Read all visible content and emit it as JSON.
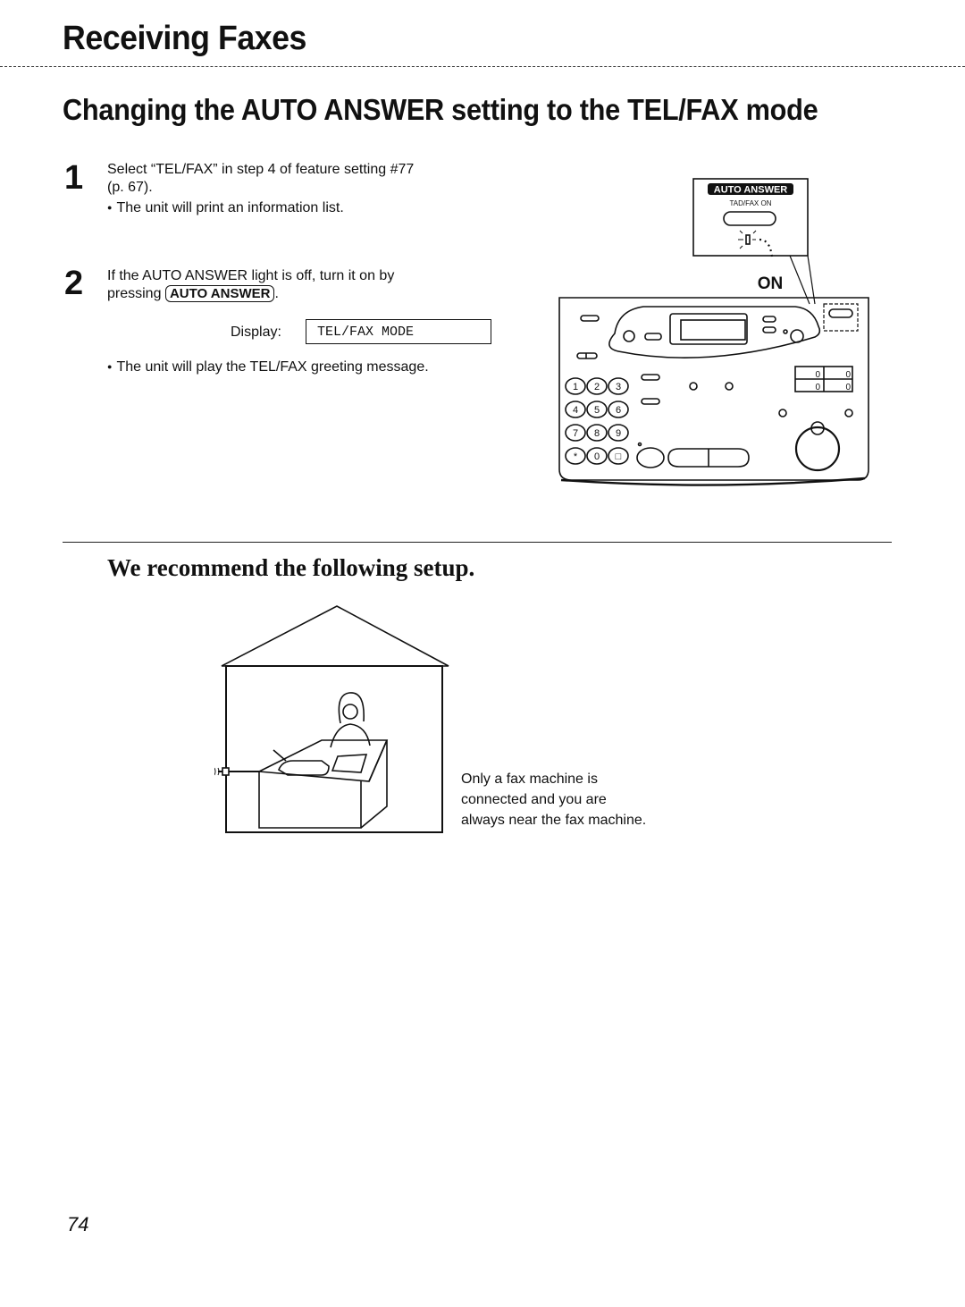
{
  "header": {
    "section_title": "Receiving Faxes",
    "subtitle": "Changing the AUTO ANSWER setting to the TEL/FAX mode"
  },
  "steps": [
    {
      "number": "1",
      "text_line1": "Select “TEL/FAX” in step 4 of feature setting #77",
      "text_line2": "(p. 67).",
      "bullet": "The unit will print an information list."
    },
    {
      "number": "2",
      "text_line1": "If the AUTO ANSWER light is off, turn it on by",
      "text_prefix": "pressing",
      "key_label": "AUTO ANSWER",
      "text_suffix": ".",
      "display_label": "Display:",
      "display_value": "TEL/FAX MODE",
      "bullet": "The unit will play the TEL/FAX greeting message."
    }
  ],
  "illustration_fax": {
    "callout_button_label": "AUTO ANSWER",
    "callout_sub_label": "TAD/FAX ON",
    "on_label": "ON",
    "keypad": [
      "1",
      "2",
      "3",
      "4",
      "5",
      "6",
      "7",
      "8",
      "9",
      "*",
      "0",
      "□"
    ],
    "counter_digits": [
      "0",
      "0",
      "0",
      "0"
    ]
  },
  "recommendation": {
    "title": "We recommend the following setup.",
    "caption_lines": [
      "Only a fax machine is",
      "connected and you are",
      "always near the fax machine."
    ]
  },
  "footer": {
    "page_number": "74"
  }
}
